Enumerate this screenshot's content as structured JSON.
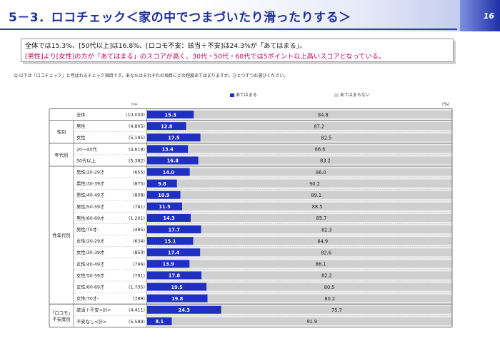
{
  "header": {
    "title": "5－3．ロコチェック＜家の中でつまづいたり滑ったりする＞",
    "page_number": "16"
  },
  "summary": {
    "line1": "全体では15.3%、[50代以上]は16.8%、[ロコモ不安：該当＋不安]は24.3%が「あてはまる」。",
    "line2": "[男性]より[女性]の方が「あてはまる」のスコアが高く、30代・50代・60代では5ポイント以上高いスコアとなっている。"
  },
  "question": "Q.以下は「ロコチェック」と呼ばれるチェック項目です。あなたはそれぞれの項目にどの程度あてはまりますか。ひとつずつお選びください。",
  "legend": {
    "applies": "あてはまる",
    "not_applies": "あてはまらない"
  },
  "n_label": "n=",
  "unit_label": "(%)",
  "colors": {
    "applies": "#1f2fc2",
    "not_applies": "#cfcfcf"
  },
  "chart_data": {
    "type": "bar",
    "orientation": "horizontal-stacked-100",
    "series": [
      {
        "name": "あてはまる",
        "values": [
          15.3,
          12.8,
          17.5,
          13.4,
          16.8,
          14.0,
          9.8,
          10.9,
          11.5,
          14.3,
          17.7,
          15.1,
          17.4,
          13.9,
          17.8,
          19.5,
          19.8,
          24.3,
          8.1
        ]
      },
      {
        "name": "あてはまらない",
        "values": [
          84.8,
          87.2,
          82.5,
          86.6,
          83.2,
          86.0,
          90.2,
          89.1,
          88.5,
          85.7,
          82.3,
          84.9,
          82.6,
          86.1,
          82.2,
          80.5,
          80.2,
          75.7,
          91.9
        ]
      }
    ],
    "groups": [
      {
        "label": "",
        "rows": [
          0
        ]
      },
      {
        "label": "性別",
        "rows": [
          1,
          2
        ]
      },
      {
        "label": "年代別",
        "rows": [
          3,
          4
        ]
      },
      {
        "label": "性年代別",
        "rows": [
          5,
          6,
          7,
          8,
          9,
          10,
          11,
          12,
          13,
          14,
          15,
          16
        ]
      },
      {
        "label": "「ロコモ」不安度別",
        "rows": [
          17,
          18
        ]
      }
    ],
    "rows": [
      {
        "label": "全体",
        "n": "(10,000)"
      },
      {
        "label": "男性",
        "n": "(4,805)"
      },
      {
        "label": "女性",
        "n": "(5,195)"
      },
      {
        "label": "20～40代",
        "n": "(4,618)"
      },
      {
        "label": "50代以上",
        "n": "(5,382)"
      },
      {
        "label": "男性/20-29才",
        "n": "(655)"
      },
      {
        "label": "男性/30-39才",
        "n": "(875)"
      },
      {
        "label": "男性/40-49才",
        "n": "(808)"
      },
      {
        "label": "男性/50-59才",
        "n": "(781)"
      },
      {
        "label": "男性/60-69才",
        "n": "(1,201)"
      },
      {
        "label": "男性/70才-",
        "n": "(485)"
      },
      {
        "label": "女性/20-29才",
        "n": "(634)"
      },
      {
        "label": "女性/30-39才",
        "n": "(850)"
      },
      {
        "label": "女性/40-49才",
        "n": "(796)"
      },
      {
        "label": "女性/50-59才",
        "n": "(791)"
      },
      {
        "label": "女性/60-69才",
        "n": "(1,735)"
      },
      {
        "label": "女性/70才-",
        "n": "(389)"
      },
      {
        "label": "該当＋不安<計>",
        "n": "(4,411)"
      },
      {
        "label": "不安なし<計>",
        "n": "(5,589)"
      }
    ],
    "xlim": [
      0,
      100
    ],
    "legend_position": "top"
  }
}
